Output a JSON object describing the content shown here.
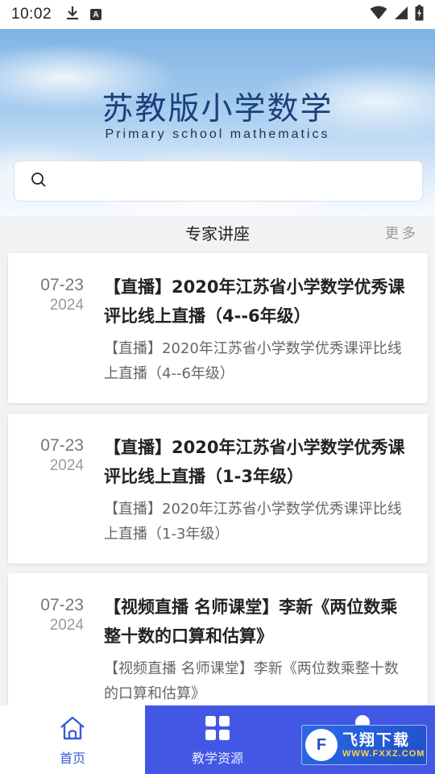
{
  "status_bar": {
    "time": "10:02",
    "icons": [
      "download-icon",
      "a-badge-icon",
      "wifi-icon",
      "signal-icon",
      "battery-icon"
    ],
    "a_badge": "A"
  },
  "header": {
    "title": "苏教版小学数学",
    "subtitle": "Primary school mathematics"
  },
  "search": {
    "placeholder": "",
    "value": ""
  },
  "section": {
    "title": "专家讲座",
    "more_label": "更多"
  },
  "cards": [
    {
      "date_md": "07-23",
      "date_year": "2024",
      "title": "【直播】2020年江苏省小学数学优秀课评比线上直播（4--6年级）",
      "desc": "【直播】2020年江苏省小学数学优秀课评比线上直播（4--6年级）"
    },
    {
      "date_md": "07-23",
      "date_year": "2024",
      "title": "【直播】2020年江苏省小学数学优秀课评比线上直播（1-3年级）",
      "desc": "【直播】2020年江苏省小学数学优秀课评比线上直播（1-3年级）"
    },
    {
      "date_md": "07-23",
      "date_year": "2024",
      "title": "【视频直播 名师课堂】李新《两位数乘整十数的口算和估算》",
      "desc": "【视频直播 名师课堂】李新《两位数乘整十数的口算和估算》"
    }
  ],
  "bottom_nav": [
    {
      "label": "首页",
      "icon": "home-icon",
      "active": true
    },
    {
      "label": "教学资源",
      "icon": "grid-icon",
      "active": false
    },
    {
      "label": "",
      "icon": "user-icon",
      "active": false
    }
  ],
  "watermark": {
    "logo": "F",
    "text": "飞翔下载",
    "url": "WWW.FXXZ.COM"
  },
  "colors": {
    "accent_blue": "#4257e3",
    "title_blue": "#1c3f7c",
    "active_nav": "#3a5bd9"
  }
}
